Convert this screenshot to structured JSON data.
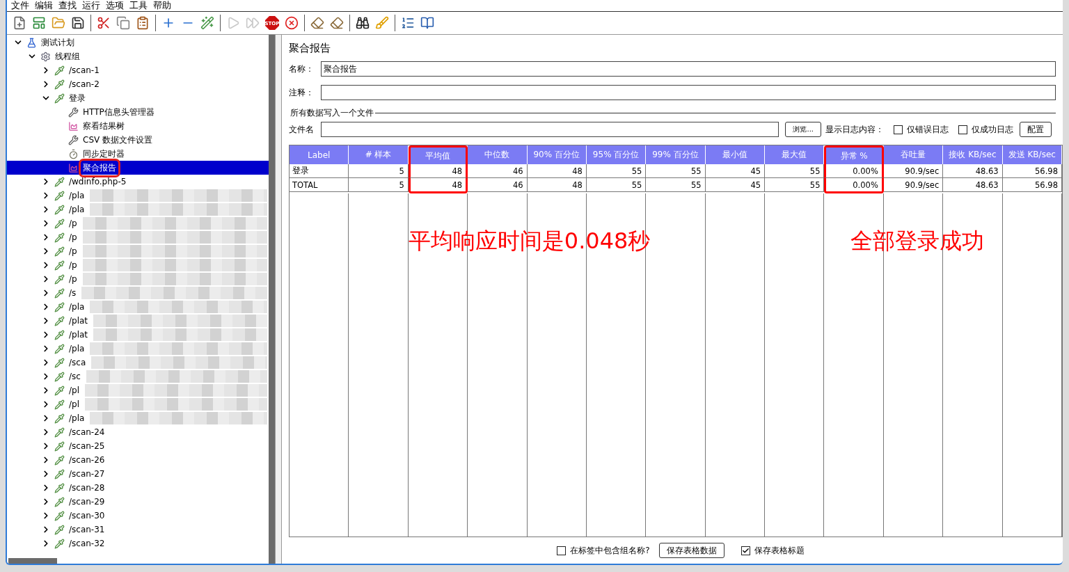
{
  "menu": [
    "文件",
    "编辑",
    "查找",
    "运行",
    "选项",
    "工具",
    "帮助"
  ],
  "toolbar": [
    {
      "kind": "new",
      "disabled": false
    },
    {
      "kind": "templates",
      "disabled": false
    },
    {
      "kind": "open",
      "disabled": false
    },
    {
      "kind": "save",
      "disabled": false
    },
    {
      "kind": "separator"
    },
    {
      "kind": "cut",
      "disabled": false
    },
    {
      "kind": "copy",
      "disabled": false
    },
    {
      "kind": "paste",
      "disabled": false
    },
    {
      "kind": "separator"
    },
    {
      "kind": "expand",
      "disabled": false
    },
    {
      "kind": "collapse",
      "disabled": false
    },
    {
      "kind": "toggle",
      "disabled": false
    },
    {
      "kind": "separator"
    },
    {
      "kind": "start",
      "disabled": true
    },
    {
      "kind": "start-no-pause",
      "disabled": true
    },
    {
      "kind": "stop",
      "label": "STOP",
      "disabled": false
    },
    {
      "kind": "shutdown",
      "disabled": false
    },
    {
      "kind": "separator"
    },
    {
      "kind": "clear",
      "disabled": false
    },
    {
      "kind": "clear-all",
      "disabled": false
    },
    {
      "kind": "separator"
    },
    {
      "kind": "search",
      "disabled": false
    },
    {
      "kind": "reset-search",
      "disabled": false
    },
    {
      "kind": "separator"
    },
    {
      "kind": "function-helper",
      "disabled": false
    },
    {
      "kind": "help",
      "disabled": false
    }
  ],
  "tree": [
    {
      "label": "测试计划",
      "kind": "plan",
      "expanded": true,
      "selected": false,
      "children": [
        {
          "label": "线程组",
          "kind": "threadgroup",
          "expanded": true,
          "selected": false,
          "children": [
            {
              "label": "/scan-1",
              "kind": "sampler",
              "expanded": false,
              "selected": false
            },
            {
              "label": "/scan-2",
              "kind": "sampler",
              "expanded": false,
              "selected": false
            },
            {
              "label": "登录",
              "kind": "sampler",
              "expanded": true,
              "selected": false,
              "children": [
                {
                  "label": "HTTP信息头管理器",
                  "kind": "config",
                  "selected": false
                },
                {
                  "label": "察看结果树",
                  "kind": "listener",
                  "selected": false
                },
                {
                  "label": "CSV 数据文件设置",
                  "kind": "config",
                  "selected": false
                },
                {
                  "label": "同步定时器",
                  "kind": "timer",
                  "selected": false
                },
                {
                  "label": "聚合报告",
                  "kind": "listener",
                  "selected": true,
                  "highlighted": true
                }
              ]
            },
            {
              "label": "/wdinfo.php-5",
              "kind": "sampler",
              "expanded": false,
              "selected": false
            },
            {
              "label": "/pla",
              "kind": "sampler",
              "expanded": false,
              "selected": false,
              "redacted": true
            },
            {
              "label": "/pla",
              "kind": "sampler",
              "expanded": false,
              "selected": false,
              "redacted": true
            },
            {
              "label": "/p",
              "kind": "sampler",
              "expanded": false,
              "selected": false,
              "redacted": true
            },
            {
              "label": "/p",
              "kind": "sampler",
              "expanded": false,
              "selected": false,
              "redacted": true
            },
            {
              "label": "/p",
              "kind": "sampler",
              "expanded": false,
              "selected": false,
              "redacted": true
            },
            {
              "label": "/p",
              "kind": "sampler",
              "expanded": false,
              "selected": false,
              "redacted": true
            },
            {
              "label": "/p",
              "kind": "sampler",
              "expanded": false,
              "selected": false,
              "redacted": true
            },
            {
              "label": "/s",
              "kind": "sampler",
              "expanded": false,
              "selected": false,
              "redacted": true
            },
            {
              "label": "/pla",
              "kind": "sampler",
              "expanded": false,
              "selected": false,
              "redacted": true
            },
            {
              "label": "/plat",
              "kind": "sampler",
              "expanded": false,
              "selected": false,
              "redacted": true
            },
            {
              "label": "/plat",
              "kind": "sampler",
              "expanded": false,
              "selected": false,
              "redacted": true
            },
            {
              "label": "/pla",
              "kind": "sampler",
              "expanded": false,
              "selected": false,
              "redacted": true
            },
            {
              "label": "/sca",
              "kind": "sampler",
              "expanded": false,
              "selected": false,
              "redacted": true
            },
            {
              "label": "/sc",
              "kind": "sampler",
              "expanded": false,
              "selected": false,
              "redacted": true
            },
            {
              "label": "/pl",
              "kind": "sampler",
              "expanded": false,
              "selected": false,
              "redacted": true
            },
            {
              "label": "/pl",
              "kind": "sampler",
              "expanded": false,
              "selected": false,
              "redacted": true
            },
            {
              "label": "/pla",
              "kind": "sampler",
              "expanded": false,
              "selected": false,
              "redacted": true
            },
            {
              "label": "/scan-24",
              "kind": "sampler",
              "expanded": false,
              "selected": false
            },
            {
              "label": "/scan-25",
              "kind": "sampler",
              "expanded": false,
              "selected": false
            },
            {
              "label": "/scan-26",
              "kind": "sampler",
              "expanded": false,
              "selected": false
            },
            {
              "label": "/scan-27",
              "kind": "sampler",
              "expanded": false,
              "selected": false
            },
            {
              "label": "/scan-28",
              "kind": "sampler",
              "expanded": false,
              "selected": false
            },
            {
              "label": "/scan-29",
              "kind": "sampler",
              "expanded": false,
              "selected": false
            },
            {
              "label": "/scan-30",
              "kind": "sampler",
              "expanded": false,
              "selected": false
            },
            {
              "label": "/scan-31",
              "kind": "sampler",
              "expanded": false,
              "selected": false
            },
            {
              "label": "/scan-32",
              "kind": "sampler",
              "expanded": false,
              "selected": false
            }
          ]
        }
      ]
    }
  ],
  "panel": {
    "title": "聚合报告",
    "name_label": "名称：",
    "name_value": "聚合报告",
    "comment_label": "注释：",
    "file_section": "所有数据写入一个文件",
    "file_label": "文件名",
    "browse_button": "浏览...",
    "log_label": "显示日志内容：",
    "log_options": [
      {
        "label": "仅错误日志",
        "checked": false
      },
      {
        "label": "仅成功日志",
        "checked": false
      }
    ],
    "config_button": "配置"
  },
  "table": {
    "columns": [
      {
        "label": "Label",
        "highlighted": false
      },
      {
        "label": "# 样本",
        "highlighted": false
      },
      {
        "label": "平均值",
        "highlighted": true
      },
      {
        "label": "中位数",
        "highlighted": false
      },
      {
        "label": "90% 百分位",
        "highlighted": false
      },
      {
        "label": "95% 百分位",
        "highlighted": false
      },
      {
        "label": "99% 百分位",
        "highlighted": false
      },
      {
        "label": "最小值",
        "highlighted": false
      },
      {
        "label": "最大值",
        "highlighted": false
      },
      {
        "label": "异常 %",
        "highlighted": true
      },
      {
        "label": "吞吐量",
        "highlighted": false
      },
      {
        "label": "接收 KB/sec",
        "highlighted": false
      },
      {
        "label": "发送 KB/sec",
        "highlighted": false
      }
    ],
    "rows": [
      [
        "登录",
        "5",
        "48",
        "46",
        "48",
        "55",
        "55",
        "45",
        "55",
        "0.00%",
        "90.9/sec",
        "48.63",
        "56.98"
      ],
      [
        "TOTAL",
        "5",
        "48",
        "46",
        "48",
        "55",
        "55",
        "45",
        "55",
        "0.00%",
        "90.9/sec",
        "48.63",
        "56.98"
      ]
    ]
  },
  "annotations": [
    {
      "text": "平均响应时间是0.048秒"
    },
    {
      "text": "全部登录成功"
    }
  ],
  "footer": {
    "group_option": {
      "label": "在标签中包含组名称?",
      "checked": false
    },
    "save_button": "保存表格数据",
    "header_option": {
      "label": "保存表格标题",
      "checked": true
    }
  }
}
